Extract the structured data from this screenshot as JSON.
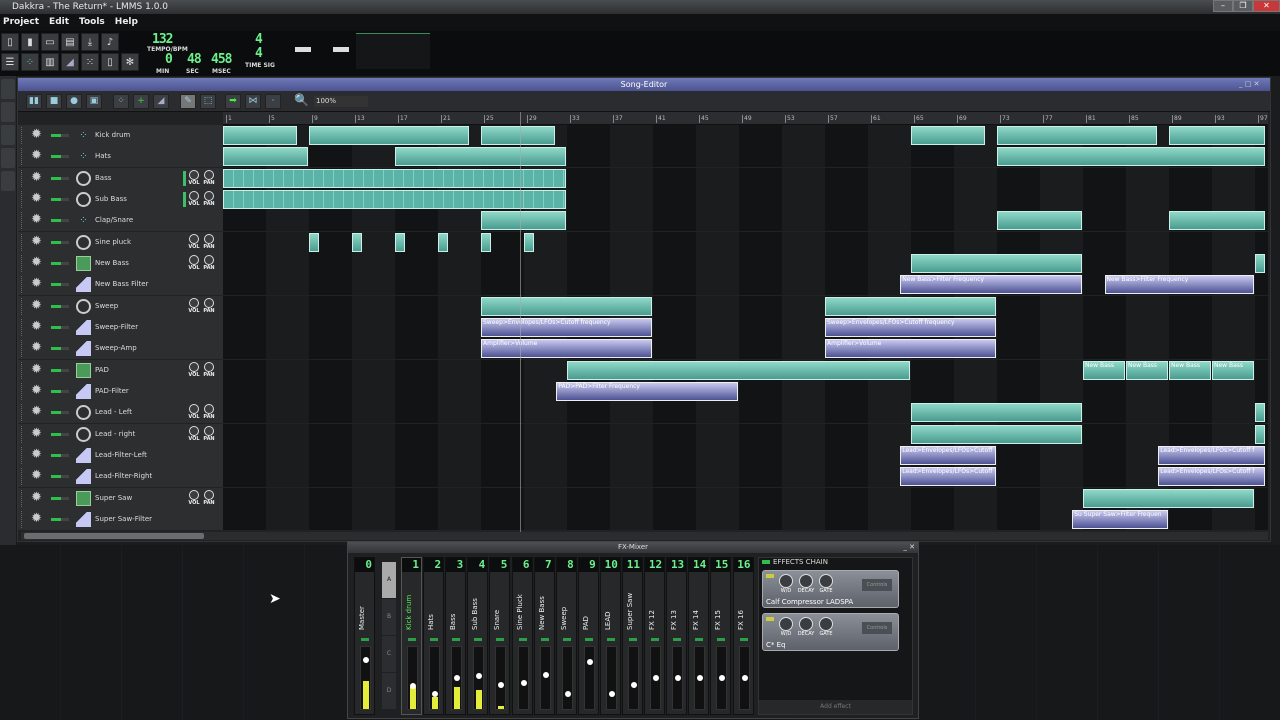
{
  "window": {
    "title": "Dakkra - The Return* - LMMS 1.0.0"
  },
  "menu": [
    "Project",
    "Edit",
    "Tools",
    "Help"
  ],
  "transport": {
    "tempo": "132",
    "tempo_label": "TEMPO/BPM",
    "min": "0",
    "sec": "48",
    "msec": "458",
    "min_label": "MIN",
    "sec_label": "SEC",
    "msec_label": "MSEC",
    "timesig_num": "4",
    "timesig_den": "4",
    "timesig_label": "TIME SIG"
  },
  "song_editor": {
    "title": "Song-Editor",
    "zoom": "100%",
    "ruler": [
      "1",
      "5",
      "9",
      "13",
      "17",
      "21",
      "25",
      "29",
      "33",
      "37",
      "41",
      "45",
      "49",
      "53",
      "57",
      "61",
      "65",
      "69",
      "73",
      "77",
      "81",
      "85",
      "89",
      "93",
      "97"
    ],
    "playhead_bar": 27.6,
    "tracks": [
      {
        "name": "Kick drum",
        "type": "beat",
        "knobs": false,
        "clips": [
          {
            "s": 0,
            "l": 7
          },
          {
            "s": 8,
            "l": 15
          },
          {
            "s": 24,
            "l": 7
          },
          {
            "s": 64,
            "l": 7
          },
          {
            "s": 72,
            "l": 15
          },
          {
            "s": 88,
            "l": 9
          }
        ]
      },
      {
        "name": "Hats",
        "type": "beat",
        "knobs": false,
        "clips": [
          {
            "s": 0,
            "l": 8
          },
          {
            "s": 16,
            "l": 16
          },
          {
            "s": 72,
            "l": 25
          }
        ]
      },
      {
        "name": "Bass",
        "type": "osc",
        "knobs": true,
        "meter": true,
        "clips": [
          {
            "s": 0,
            "l": 32,
            "pat": true
          }
        ]
      },
      {
        "name": "Sub Bass",
        "type": "osc",
        "knobs": true,
        "meter": true,
        "clips": [
          {
            "s": 0,
            "l": 32,
            "pat": true
          }
        ]
      },
      {
        "name": "Clap/Snare",
        "type": "beat",
        "knobs": false,
        "clips": [
          {
            "s": 24,
            "l": 8
          },
          {
            "s": 72,
            "l": 8
          },
          {
            "s": 88,
            "l": 9
          }
        ]
      },
      {
        "name": "Sine pluck",
        "type": "osc",
        "knobs": true,
        "clips": [
          {
            "s": 8,
            "l": 1
          },
          {
            "s": 12,
            "l": 1
          },
          {
            "s": 16,
            "l": 1
          },
          {
            "s": 20,
            "l": 1
          },
          {
            "s": 24,
            "l": 1
          },
          {
            "s": 28,
            "l": 1
          }
        ]
      },
      {
        "name": "New Bass",
        "type": "plugin",
        "knobs": true,
        "clips": [
          {
            "s": 64,
            "l": 16
          },
          {
            "s": 96,
            "l": 1
          }
        ]
      },
      {
        "name": "New Bass Filter",
        "type": "auto",
        "knobs": false,
        "clips": [
          {
            "s": 63,
            "l": 17,
            "label": "New Bass>Filter Frequency"
          },
          {
            "s": 82,
            "l": 14,
            "label": "New Bass>Filter Frequency"
          }
        ]
      },
      {
        "name": "Sweep",
        "type": "osc",
        "knobs": true,
        "clips": [
          {
            "s": 24,
            "l": 16
          },
          {
            "s": 56,
            "l": 16
          }
        ]
      },
      {
        "name": "Sweep-Filter",
        "type": "auto",
        "knobs": false,
        "clips": [
          {
            "s": 24,
            "l": 16,
            "label": "Sweep>Envelopes/LFOs>Cutoff frequency"
          },
          {
            "s": 56,
            "l": 16,
            "label": "Sweep>Envelopes/LFOs>Cutoff frequency"
          }
        ]
      },
      {
        "name": "Sweep-Amp",
        "type": "auto",
        "knobs": false,
        "clips": [
          {
            "s": 24,
            "l": 16,
            "label": "Amplifier>Volume"
          },
          {
            "s": 56,
            "l": 16,
            "label": "Amplifier>Volume"
          }
        ]
      },
      {
        "name": "PAD",
        "type": "plugin",
        "knobs": true,
        "clips": [
          {
            "s": 32,
            "l": 32
          },
          {
            "s": 80,
            "l": 4,
            "label": "New Bass"
          },
          {
            "s": 84,
            "l": 4,
            "label": "New Bass"
          },
          {
            "s": 88,
            "l": 4,
            "label": "New Bass"
          },
          {
            "s": 92,
            "l": 4,
            "label": "New Bass"
          }
        ]
      },
      {
        "name": "PAD-Filter",
        "type": "auto",
        "knobs": false,
        "clips": [
          {
            "s": 31,
            "l": 17,
            "label": "PAD>PAD>Filter Frequency"
          }
        ]
      },
      {
        "name": "Lead - Left",
        "type": "osc",
        "knobs": true,
        "clips": [
          {
            "s": 64,
            "l": 16
          },
          {
            "s": 96,
            "l": 1
          }
        ]
      },
      {
        "name": "Lead - right",
        "type": "osc",
        "knobs": true,
        "clips": [
          {
            "s": 64,
            "l": 16
          },
          {
            "s": 96,
            "l": 1
          }
        ]
      },
      {
        "name": "Lead-Filter-Left",
        "type": "auto",
        "knobs": false,
        "clips": [
          {
            "s": 63,
            "l": 9,
            "label": "Lead>Envelopes/LFOs>Cutoff"
          },
          {
            "s": 87,
            "l": 10,
            "label": "Lead>Envelopes/LFOs>Cutoff f"
          }
        ]
      },
      {
        "name": "Lead-Filter-Right",
        "type": "auto",
        "knobs": false,
        "clips": [
          {
            "s": 63,
            "l": 9,
            "label": "Lead>Envelopes/LFOs>Cutoff"
          },
          {
            "s": 87,
            "l": 10,
            "label": "Lead>Envelopes/LFOs>Cutoff f"
          }
        ]
      },
      {
        "name": "Super Saw",
        "type": "plugin",
        "knobs": true,
        "clips": [
          {
            "s": 80,
            "l": 16
          }
        ]
      },
      {
        "name": "Super Saw-Filter",
        "type": "auto",
        "knobs": false,
        "clips": [
          {
            "s": 79,
            "l": 9,
            "label": "Su Super Saw>Filter Frequen"
          }
        ]
      }
    ],
    "knob_labels": {
      "vol": "VOL",
      "pan": "PAN"
    }
  },
  "mixer": {
    "title": "FX-Mixer",
    "banks": [
      "A",
      "B",
      "C",
      "D"
    ],
    "channels": [
      {
        "num": "0",
        "name": "Master",
        "fader": 0.83,
        "meter": 0.45
      },
      {
        "num": "1",
        "name": "Kick drum",
        "fader": 0.36,
        "meter": 0.35
      },
      {
        "num": "2",
        "name": "Hats",
        "fader": 0.21,
        "meter": 0.2
      },
      {
        "num": "3",
        "name": "Bass",
        "fader": 0.5,
        "meter": 0.35
      },
      {
        "num": "4",
        "name": "Sub Bass",
        "fader": 0.54,
        "meter": 0.3
      },
      {
        "num": "5",
        "name": "Snare",
        "fader": 0.37,
        "meter": 0.05
      },
      {
        "num": "6",
        "name": "Sine Pluck",
        "fader": 0.41,
        "meter": 0
      },
      {
        "num": "7",
        "name": "New Bass",
        "fader": 0.56,
        "meter": 0
      },
      {
        "num": "8",
        "name": "Sweep",
        "fader": 0.21,
        "meter": 0
      },
      {
        "num": "9",
        "name": "PAD",
        "fader": 0.79,
        "meter": 0
      },
      {
        "num": "10",
        "name": "LEAD",
        "fader": 0.21,
        "meter": 0
      },
      {
        "num": "11",
        "name": "Super Saw",
        "fader": 0.37,
        "meter": 0
      },
      {
        "num": "12",
        "name": "FX 12",
        "fader": 0.5,
        "meter": 0
      },
      {
        "num": "13",
        "name": "FX 13",
        "fader": 0.5,
        "meter": 0
      },
      {
        "num": "14",
        "name": "FX 14",
        "fader": 0.5,
        "meter": 0
      },
      {
        "num": "15",
        "name": "FX 15",
        "fader": 0.5,
        "meter": 0
      },
      {
        "num": "16",
        "name": "FX 16",
        "fader": 0.5,
        "meter": 0
      }
    ],
    "effects_chain": {
      "title": "EFFECTS CHAIN",
      "effects": [
        {
          "name": "Calf Compressor LADSPA",
          "knobs": [
            "W/D",
            "DECAY",
            "GATE"
          ],
          "controls": "Controls"
        },
        {
          "name": "C* Eq",
          "knobs": [
            "W/D",
            "DECAY",
            "GATE"
          ],
          "controls": "Controls"
        }
      ],
      "add_effect": "Add effect"
    }
  }
}
